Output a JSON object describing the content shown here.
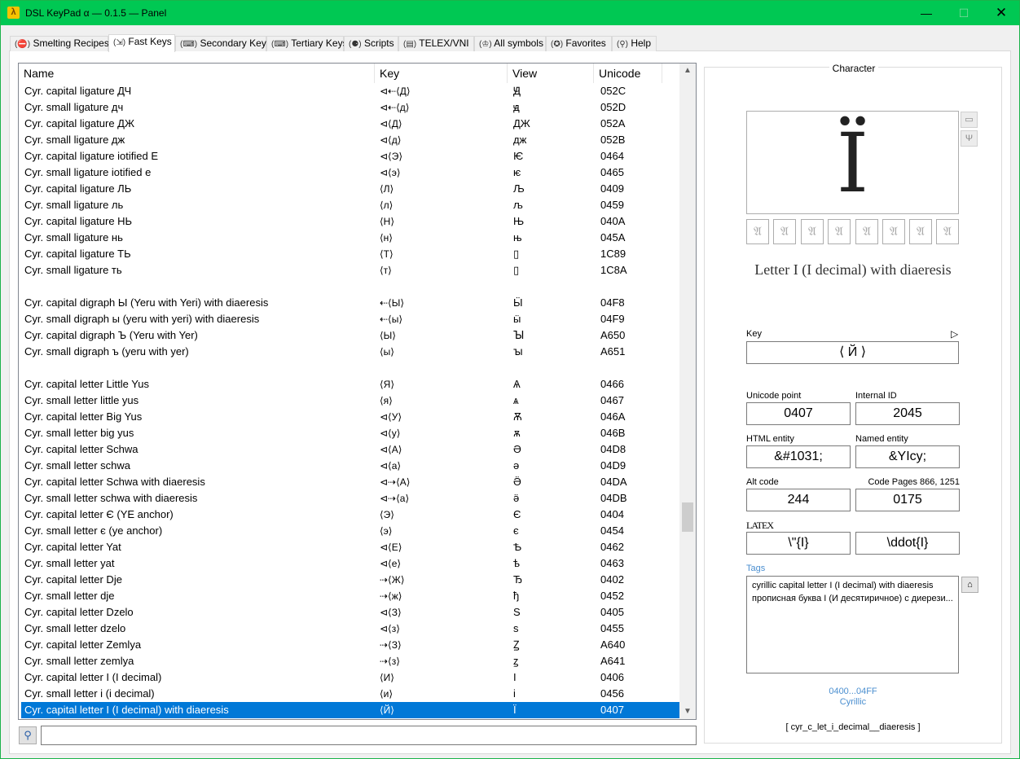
{
  "window": {
    "title": "DSL KeyPad α — 0.1.5 — Panel",
    "app_icon": "λ",
    "minimize": "—",
    "maximize": "☐",
    "close": "✕"
  },
  "tabs": [
    {
      "icon": "(⛔)",
      "label": "Smelting Recipes"
    },
    {
      "icon": "(⇲)",
      "label": "Fast Keys"
    },
    {
      "icon": "(⌨)",
      "label": "Secondary Keys"
    },
    {
      "icon": "(⌨)",
      "label": "Tertiary Keys"
    },
    {
      "icon": "(⚈)",
      "label": "Scripts"
    },
    {
      "icon": "(▤)",
      "label": "TELEX/VNI"
    },
    {
      "icon": "(♔)",
      "label": "All symbols"
    },
    {
      "icon": "(✪)",
      "label": "Favorites"
    },
    {
      "icon": "(⚲)",
      "label": "Help"
    }
  ],
  "list": {
    "columns": [
      "Name",
      "Key",
      "View",
      "Unicode"
    ],
    "rows": [
      {
        "name": "Cyr. capital ligature ДЧ",
        "key": "⊲⇠⟨Д⟩",
        "view": "Ԭ",
        "unicode": "052C"
      },
      {
        "name": "Cyr. small ligature дч",
        "key": "⊲⇠⟨д⟩",
        "view": "ԭ",
        "unicode": "052D"
      },
      {
        "name": "Cyr. capital ligature ДЖ",
        "key": "⊲⟨Д⟩",
        "view": "ДЖ",
        "unicode": "052A"
      },
      {
        "name": "Cyr. small ligature дж",
        "key": "⊲⟨д⟩",
        "view": "дж",
        "unicode": "052B"
      },
      {
        "name": "Cyr. capital ligature iotified E",
        "key": "⊲⟨Э⟩",
        "view": "Ѥ",
        "unicode": "0464"
      },
      {
        "name": "Cyr. small ligature iotified e",
        "key": "⊲⟨э⟩",
        "view": "ѥ",
        "unicode": "0465"
      },
      {
        "name": "Cyr. capital ligature ЛЬ",
        "key": "⟨Л⟩",
        "view": "Љ",
        "unicode": "0409"
      },
      {
        "name": "Cyr. small ligature ль",
        "key": "⟨л⟩",
        "view": "љ",
        "unicode": "0459"
      },
      {
        "name": "Cyr. capital ligature НЬ",
        "key": "⟨Н⟩",
        "view": "Њ",
        "unicode": "040A"
      },
      {
        "name": "Cyr. small ligature нь",
        "key": "⟨н⟩",
        "view": "њ",
        "unicode": "045A"
      },
      {
        "name": "Cyr. capital ligature ТЬ",
        "key": "⟨Т⟩",
        "view": "▯",
        "unicode": "1C89"
      },
      {
        "name": "Cyr. small ligature ть",
        "key": "⟨т⟩",
        "view": "▯",
        "unicode": "1C8A"
      },
      {
        "name": "",
        "key": "",
        "view": "",
        "unicode": ""
      },
      {
        "name": "Cyr. capital digraph Ы (Yeru with Yeri) with diaeresis",
        "key": "⇠⟨Ы⟩",
        "view": "Ӹ",
        "unicode": "04F8"
      },
      {
        "name": "Cyr. small digraph ы (yeru with yeri) with diaeresis",
        "key": "⇠⟨ы⟩",
        "view": "ӹ",
        "unicode": "04F9"
      },
      {
        "name": "Cyr. capital digraph Ъ (Yeru with Yer)",
        "key": "⟨Ы⟩",
        "view": "Ꙑ",
        "unicode": "A650"
      },
      {
        "name": "Cyr. small digraph ъ (yeru with yer)",
        "key": "⟨ы⟩",
        "view": "ꙑ",
        "unicode": "A651"
      },
      {
        "name": "",
        "key": "",
        "view": "",
        "unicode": ""
      },
      {
        "name": "Cyr. capital letter Little Yus",
        "key": "⟨Я⟩",
        "view": "Ѧ",
        "unicode": "0466"
      },
      {
        "name": "Cyr. small letter little yus",
        "key": "⟨я⟩",
        "view": "ѧ",
        "unicode": "0467"
      },
      {
        "name": "Cyr. capital letter Big Yus",
        "key": "⊲⟨У⟩",
        "view": "Ѫ",
        "unicode": "046A"
      },
      {
        "name": "Cyr. small letter big yus",
        "key": "⊲⟨у⟩",
        "view": "ѫ",
        "unicode": "046B"
      },
      {
        "name": "Cyr. capital letter Schwa",
        "key": "⊲⟨А⟩",
        "view": "Ә",
        "unicode": "04D8"
      },
      {
        "name": "Cyr. small letter schwa",
        "key": "⊲⟨а⟩",
        "view": "ә",
        "unicode": "04D9"
      },
      {
        "name": "Cyr. capital letter Schwa with diaeresis",
        "key": "⊲⇢⟨А⟩",
        "view": "Ӛ",
        "unicode": "04DA"
      },
      {
        "name": "Cyr. small letter schwa with diaeresis",
        "key": "⊲⇢⟨а⟩",
        "view": "ӛ",
        "unicode": "04DB"
      },
      {
        "name": "Cyr. capital letter Є (YE anchor)",
        "key": "⟨Э⟩",
        "view": "Є",
        "unicode": "0404"
      },
      {
        "name": "Cyr. small letter є (ye anchor)",
        "key": "⟨э⟩",
        "view": "є",
        "unicode": "0454"
      },
      {
        "name": "Cyr. capital letter Yat",
        "key": "⊲⟨Е⟩",
        "view": "Ѣ",
        "unicode": "0462"
      },
      {
        "name": "Cyr. small letter yat",
        "key": "⊲⟨е⟩",
        "view": "ѣ",
        "unicode": "0463"
      },
      {
        "name": "Cyr. capital letter Dje",
        "key": "⇢⟨Ж⟩",
        "view": "Ђ",
        "unicode": "0402"
      },
      {
        "name": "Cyr. small letter dje",
        "key": "⇢⟨ж⟩",
        "view": "ђ",
        "unicode": "0452"
      },
      {
        "name": "Cyr. capital letter Dzelo",
        "key": "⊲⟨З⟩",
        "view": "Ѕ",
        "unicode": "0405"
      },
      {
        "name": "Cyr. small letter dzelo",
        "key": "⊲⟨з⟩",
        "view": "ѕ",
        "unicode": "0455"
      },
      {
        "name": "Cyr. capital letter Zemlya",
        "key": "⇢⟨З⟩",
        "view": "Ꙁ",
        "unicode": "A640"
      },
      {
        "name": "Cyr. small letter zemlya",
        "key": "⇢⟨з⟩",
        "view": "ꙁ",
        "unicode": "A641"
      },
      {
        "name": "Cyr. capital letter I (I decimal)",
        "key": "⟨И⟩",
        "view": "І",
        "unicode": "0406"
      },
      {
        "name": "Cyr. small letter i (i decimal)",
        "key": "⟨и⟩",
        "view": "і",
        "unicode": "0456"
      },
      {
        "name": "Cyr. capital letter I (I decimal) with diaeresis",
        "key": "⟨Й⟩",
        "view": "Ї",
        "unicode": "0407",
        "selected": true
      }
    ]
  },
  "scrollbar": {
    "up": "▲",
    "down": "▼"
  },
  "search": {
    "icon": "⚲",
    "value": "",
    "placeholder": ""
  },
  "character": {
    "panel_title": "Character",
    "glyph": "Ї",
    "side_buttons": [
      "▭",
      "Ψ"
    ],
    "variants": [
      "𝔄",
      "𝔄",
      "𝔄",
      "𝔄",
      "𝔄",
      "𝔄",
      "𝔄",
      "𝔄"
    ],
    "name": "Letter I (I decimal) with diaeresis",
    "key_label": "Key",
    "key_arrow": "▷",
    "key_value": "⟨ Й ⟩",
    "unicode_label": "Unicode point",
    "unicode_value": "0407",
    "internal_label": "Internal ID",
    "internal_value": "2045",
    "html_label": "HTML entity",
    "html_value": "&#1031;",
    "named_label": "Named entity",
    "named_value": "&YIcy;",
    "alt_label": "Alt code",
    "alt_value": "244",
    "cp_label": "Code Pages 866, 1251",
    "cp_value": "0175",
    "latex_label": "LATEX",
    "latex_value1": "\\\"{I}",
    "latex_value2": "\\ddot{I}",
    "tags_label": "Tags",
    "tags": [
      "cyrillic capital letter I (I decimal) with diaeresis",
      "прописная буква І (И десятиричное) с диерези..."
    ],
    "tag_btn": "⌂",
    "block_range": "0400...04FF",
    "block_name": "Cyrillic",
    "internal_code": "[    cyr_c_let_i_decimal__diaeresis    ]"
  }
}
